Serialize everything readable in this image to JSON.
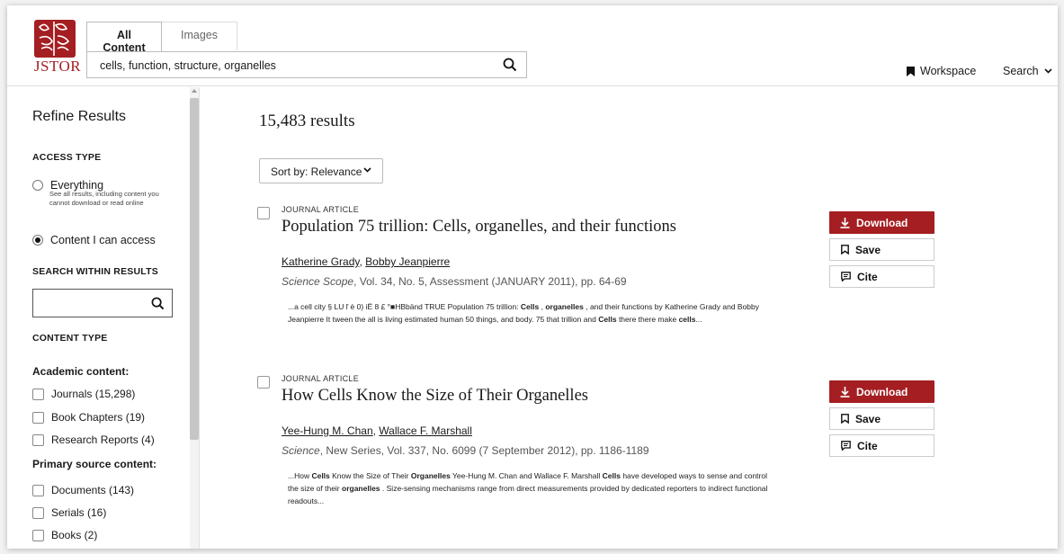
{
  "brand": {
    "logo_text": "JSTOR",
    "color": "#a41e22"
  },
  "tabs": [
    {
      "label": "All Content",
      "active": true
    },
    {
      "label": "Images",
      "active": false
    }
  ],
  "search": {
    "value": "cells, function, structure, organelles"
  },
  "nav": {
    "workspace": "Workspace",
    "search": "Search"
  },
  "sidebar": {
    "title": "Refine Results",
    "access_type": {
      "label": "ACCESS TYPE",
      "options": [
        {
          "label": "Everything",
          "sub": "See all results, including content you cannot download or read online",
          "selected": false
        },
        {
          "label": "Content I can access",
          "selected": true
        }
      ]
    },
    "search_within": {
      "label": "SEARCH WITHIN RESULTS",
      "value": ""
    },
    "content_type": {
      "label": "CONTENT TYPE",
      "academic_label": "Academic content:",
      "academic": [
        "Journals (15,298)",
        "Book Chapters (19)",
        "Research Reports (4)"
      ],
      "primary_label": "Primary source content:",
      "primary": [
        "Documents (143)",
        "Serials (16)",
        "Books (2)"
      ]
    }
  },
  "results": {
    "count": "15,483 results",
    "sort_label": "Sort by: Relevance",
    "items": [
      {
        "type": "JOURNAL ARTICLE",
        "title": "Population 75 trillion: Cells, organelles, and their functions",
        "authors": [
          "Katherine Grady",
          "Bobby Jeanpierre"
        ],
        "journal": "Science Scope",
        "source_rest": ", Vol. 34, No. 5, Assessment (JANUARY 2011), pp. 64-69",
        "snippet": "...a cell city § LU ľ è 0) iË 8 £ °■HBbänd TRUE Population 75 trillion: Cells , organelles , and their functions by Katherine Grady and Bobby Jeanpierre It tween the all is living estimated human 50 things, and body. 75 that trillion and Cells there there make cells...",
        "download": "Download",
        "save": "Save",
        "cite": "Cite"
      },
      {
        "type": "JOURNAL ARTICLE",
        "title": "How Cells Know the Size of Their Organelles",
        "authors": [
          "Yee-Hung M. Chan",
          "Wallace F. Marshall"
        ],
        "journal": "Science",
        "source_rest": ", New Series, Vol. 337, No. 6099 (7 September 2012), pp. 1186-1189",
        "snippet": "...How Cells Know the Size of Their Organelles Yee-Hung M. Chan and Wallace F. Marshall Cells have developed ways to sense and control the size of their organelles . Size-sensing mechanisms range from direct measurements provided by dedicated reporters to indirect functional readouts...",
        "download": "Download",
        "save": "Save",
        "cite": "Cite"
      }
    ]
  }
}
